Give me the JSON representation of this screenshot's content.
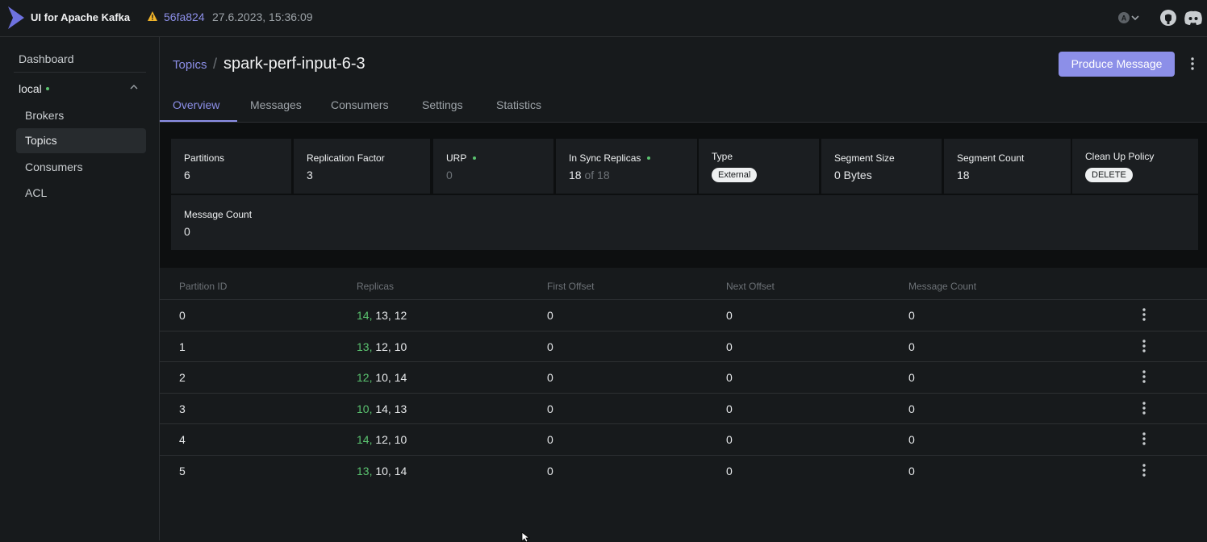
{
  "app": {
    "title": "UI for Apache Kafka",
    "commit": "56fa824",
    "build_date": "27.6.2023, 15:36:09",
    "theme_badge": "A",
    "accent": "#8c8fe8",
    "ok_color": "#5ac26f"
  },
  "sidebar": {
    "dashboard": "Dashboard",
    "cluster": "local",
    "items": [
      {
        "label": "Brokers"
      },
      {
        "label": "Topics",
        "active": true
      },
      {
        "label": "Consumers"
      },
      {
        "label": "ACL"
      }
    ]
  },
  "header": {
    "breadcrumb": "Topics",
    "separator": "/",
    "title": "spark-perf-input-6-3",
    "produce_label": "Produce Message"
  },
  "tabs": [
    {
      "label": "Overview",
      "active": true
    },
    {
      "label": "Messages"
    },
    {
      "label": "Consumers"
    },
    {
      "label": "Settings"
    },
    {
      "label": "Statistics"
    }
  ],
  "stats": {
    "partitions": {
      "label": "Partitions",
      "value": "6"
    },
    "replication": {
      "label": "Replication Factor",
      "value": "3"
    },
    "urp": {
      "label": "URP",
      "value": "0"
    },
    "isr": {
      "label": "In Sync Replicas",
      "value": "18",
      "of": "of 18"
    },
    "type": {
      "label": "Type",
      "value": "External"
    },
    "segment_size": {
      "label": "Segment Size",
      "value": "0 Bytes"
    },
    "segment_count": {
      "label": "Segment Count",
      "value": "18"
    },
    "cleanup": {
      "label": "Clean Up Policy",
      "value": "DELETE"
    },
    "message_count": {
      "label": "Message Count",
      "value": "0"
    }
  },
  "table": {
    "headers": [
      "Partition ID",
      "Replicas",
      "First Offset",
      "Next Offset",
      "Message Count"
    ],
    "rows": [
      {
        "id": "0",
        "leader": "14,",
        "replicas": "13, 12",
        "first": "0",
        "next": "0",
        "count": "0"
      },
      {
        "id": "1",
        "leader": "13,",
        "replicas": "12, 10",
        "first": "0",
        "next": "0",
        "count": "0"
      },
      {
        "id": "2",
        "leader": "12,",
        "replicas": "10, 14",
        "first": "0",
        "next": "0",
        "count": "0"
      },
      {
        "id": "3",
        "leader": "10,",
        "replicas": "14, 13",
        "first": "0",
        "next": "0",
        "count": "0"
      },
      {
        "id": "4",
        "leader": "14,",
        "replicas": "12, 10",
        "first": "0",
        "next": "0",
        "count": "0"
      },
      {
        "id": "5",
        "leader": "13,",
        "replicas": "10, 14",
        "first": "0",
        "next": "0",
        "count": "0"
      }
    ]
  }
}
